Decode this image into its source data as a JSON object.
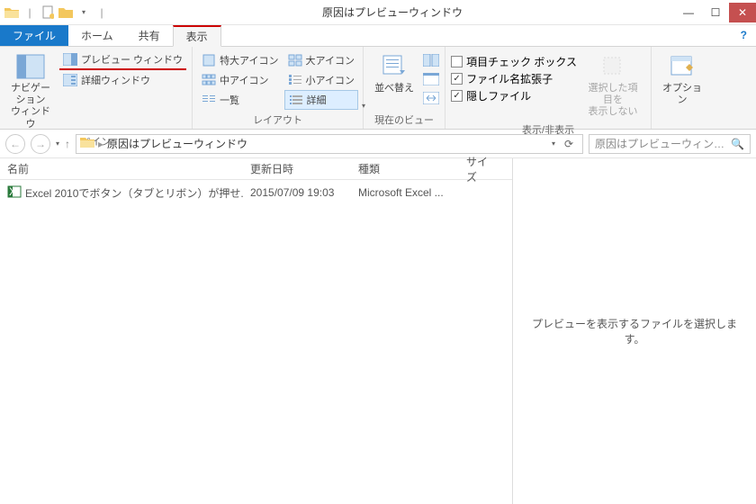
{
  "window": {
    "title": "原因はプレビューウィンドウ"
  },
  "tabs": {
    "file": "ファイル",
    "home": "ホーム",
    "share": "共有",
    "view": "表示"
  },
  "ribbon": {
    "pane": {
      "nav": "ナビゲーション\nウィンドウ",
      "preview": "プレビュー ウィンドウ",
      "details": "詳細ウィンドウ",
      "label": "ペイン"
    },
    "layout": {
      "xlarge": "特大アイコン",
      "large": "大アイコン",
      "medium": "中アイコン",
      "small": "小アイコン",
      "list": "一覧",
      "details": "詳細",
      "label": "レイアウト"
    },
    "current": {
      "sort": "並べ替え",
      "label": "現在のビュー"
    },
    "show": {
      "check_boxes": "項目チェック ボックス",
      "ext": "ファイル名拡張子",
      "hidden": "隠しファイル",
      "hide_btn": "選択した項目を\n表示しない",
      "label": "表示/非表示"
    },
    "options": "オプション"
  },
  "address": {
    "crumb": "原因はプレビューウィンドウ"
  },
  "search": {
    "placeholder": "原因はプレビューウィンドウの検索"
  },
  "columns": {
    "name": "名前",
    "date": "更新日時",
    "type": "種類",
    "size": "サイズ"
  },
  "files": [
    {
      "name": "Excel 2010でボタン（タブとリボン）が押せ...",
      "date": "2015/07/09 19:03",
      "type": "Microsoft Excel ..."
    }
  ],
  "preview": {
    "empty": "プレビューを表示するファイルを選択します。"
  }
}
